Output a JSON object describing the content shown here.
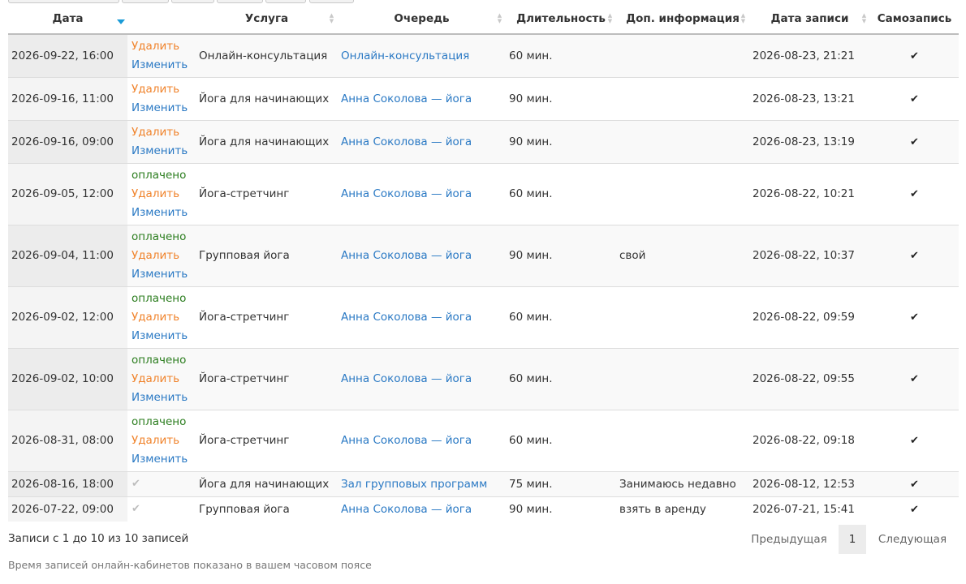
{
  "table": {
    "headers": {
      "date": "Дата",
      "actions": "",
      "service": "Услуга",
      "queue": "Очередь",
      "duration": "Длительность",
      "extra_info": "Доп. информация",
      "created": "Дата записи",
      "self_booking": "Самозапись"
    },
    "action_labels": {
      "delete": "Удалить",
      "edit": "Изменить",
      "paid": "оплачено"
    },
    "check_glyph": "✔",
    "rows": [
      {
        "date": "2026-09-22, 16:00",
        "paid": false,
        "editable": true,
        "service": "Онлайн-консультация",
        "queue": "Онлайн-консультация",
        "duration": "60 мин.",
        "info": "",
        "created": "2026-08-23, 21:21"
      },
      {
        "date": "2026-09-16, 11:00",
        "paid": false,
        "editable": true,
        "service": "Йога для начинающих",
        "queue": "Анна Соколова — йога",
        "duration": "90 мин.",
        "info": "",
        "created": "2026-08-23, 13:21"
      },
      {
        "date": "2026-09-16, 09:00",
        "paid": false,
        "editable": true,
        "service": "Йога для начинающих",
        "queue": "Анна Соколова — йога",
        "duration": "90 мин.",
        "info": "",
        "created": "2026-08-23, 13:19"
      },
      {
        "date": "2026-09-05, 12:00",
        "paid": true,
        "editable": true,
        "service": "Йога-стретчинг",
        "queue": "Анна Соколова — йога",
        "duration": "60 мин.",
        "info": "",
        "created": "2026-08-22, 10:21"
      },
      {
        "date": "2026-09-04, 11:00",
        "paid": true,
        "editable": true,
        "service": "Групповая йога",
        "queue": "Анна Соколова — йога",
        "duration": "90 мин.",
        "info": "свой",
        "created": "2026-08-22, 10:37"
      },
      {
        "date": "2026-09-02, 12:00",
        "paid": true,
        "editable": true,
        "service": "Йога-стретчинг",
        "queue": "Анна Соколова — йога",
        "duration": "60 мин.",
        "info": "",
        "created": "2026-08-22, 09:59"
      },
      {
        "date": "2026-09-02, 10:00",
        "paid": true,
        "editable": true,
        "service": "Йога-стретчинг",
        "queue": "Анна Соколова — йога",
        "duration": "60 мин.",
        "info": "",
        "created": "2026-08-22, 09:55"
      },
      {
        "date": "2026-08-31, 08:00",
        "paid": true,
        "editable": true,
        "service": "Йога-стретчинг",
        "queue": "Анна Соколова — йога",
        "duration": "60 мин.",
        "info": "",
        "created": "2026-08-22, 09:18"
      },
      {
        "date": "2026-08-16, 18:00",
        "paid": false,
        "editable": false,
        "service": "Йога для начинающих",
        "queue": "Зал групповых программ",
        "duration": "75 мин.",
        "info": "Занимаюсь недавно",
        "created": "2026-08-12, 12:53"
      },
      {
        "date": "2026-07-22, 09:00",
        "paid": false,
        "editable": false,
        "service": "Групповая йога",
        "queue": "Анна Соколова — йога",
        "duration": "90 мин.",
        "info": "взять в аренду",
        "created": "2026-07-21, 15:41"
      }
    ]
  },
  "footer": {
    "info": "Записи с 1 до 10 из 10 записей",
    "pagination": {
      "prev": "Предыдущая",
      "current": "1",
      "next": "Следующая"
    },
    "timezone_note": "Время записей онлайн-кабинетов показано в вашем часовом поясе"
  },
  "colors": {
    "delete": "#f0832b",
    "edit": "#2a79c4",
    "paid": "#2b7d1e",
    "link": "#2a79c4",
    "sort_active": "#1a9bd7"
  }
}
